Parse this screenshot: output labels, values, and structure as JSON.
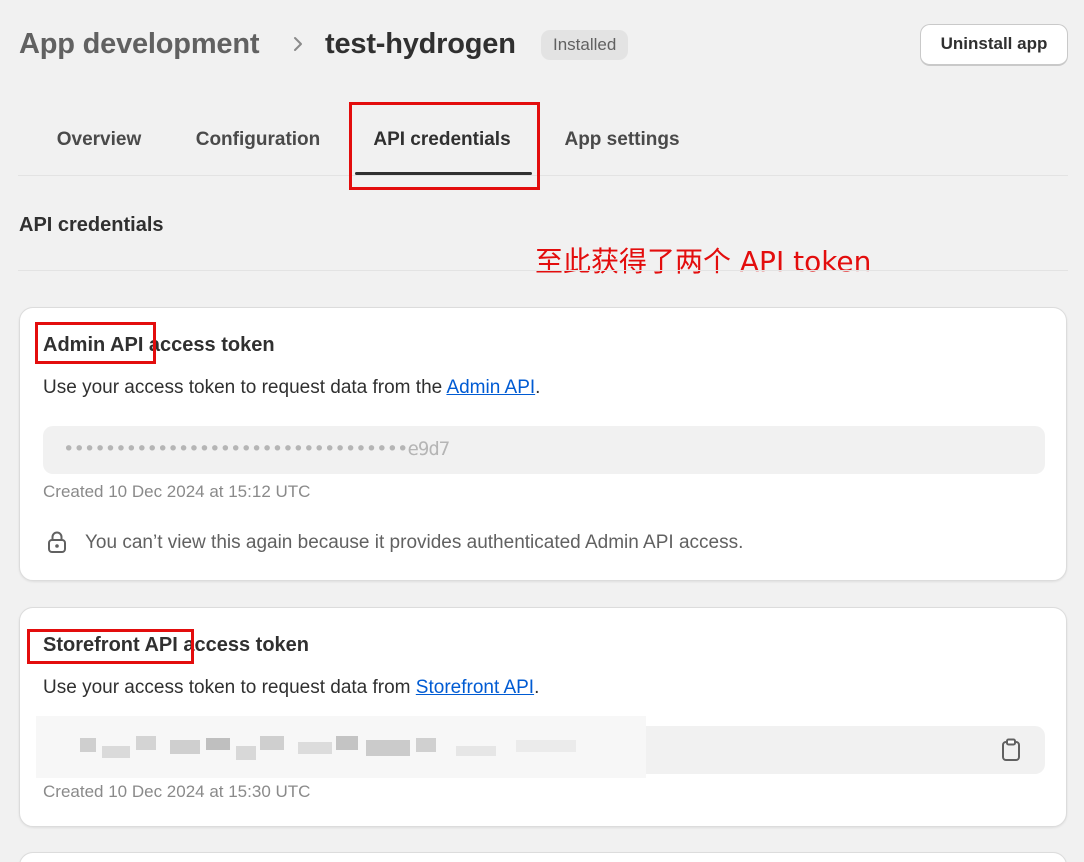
{
  "header": {
    "parent": "App development",
    "current": "test-hydrogen",
    "badge": "Installed",
    "uninstall_label": "Uninstall app"
  },
  "tabs": [
    {
      "label": "Overview"
    },
    {
      "label": "Configuration"
    },
    {
      "label": "API credentials",
      "active": true
    },
    {
      "label": "App settings"
    }
  ],
  "section_title": "API credentials",
  "annotation": "至此获得了两个 API token",
  "admin_card": {
    "title": "Admin API access token",
    "desc_prefix": "Use your access token to request data from the ",
    "desc_link": "Admin API",
    "desc_suffix": ".",
    "token_masked": "•••••••••••••••••••••••••••••••••e9d7",
    "created": "Created 10 Dec 2024 at 15:12 UTC",
    "warning": "You can’t view this again because it provides authenticated Admin API access."
  },
  "storefront_card": {
    "title": "Storefront API access token",
    "desc_prefix": "Use your access token to request data from ",
    "desc_link": "Storefront API",
    "desc_suffix": ".",
    "created": "Created 10 Dec 2024 at 15:30 UTC"
  },
  "colors": {
    "annotation_red": "#e30d0d",
    "link_blue": "#005bd3",
    "page_bg": "#f1f1f1"
  },
  "icons": [
    "chevron-right-icon",
    "lock-icon",
    "clipboard-icon"
  ]
}
